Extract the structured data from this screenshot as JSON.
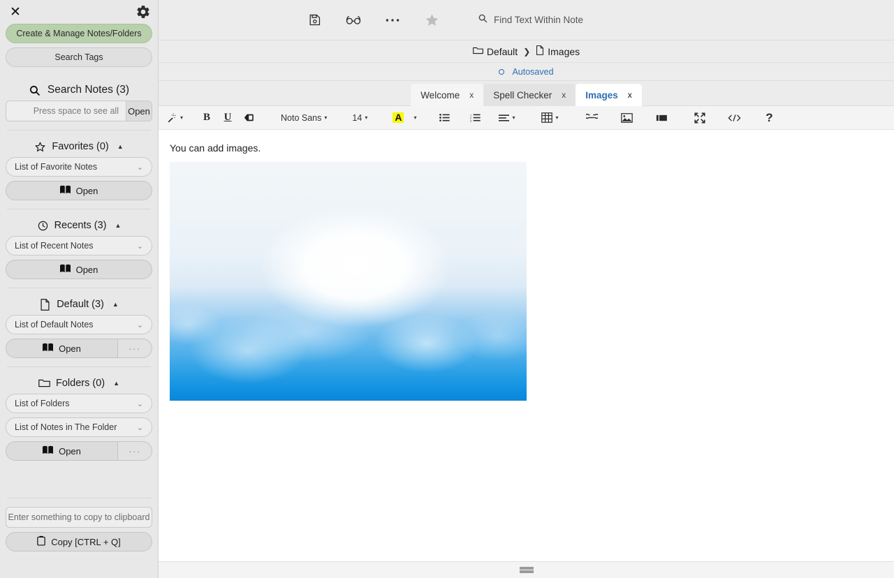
{
  "sidebar": {
    "close_label": "✕",
    "gear_name": "settings-gear",
    "create_manage_label": "Create & Manage Notes/Folders",
    "search_tags_label": "Search Tags",
    "search_notes": {
      "title": "Search Notes (3)",
      "placeholder": "Press space to see all",
      "value": "",
      "open_label": "Open"
    },
    "sections": [
      {
        "id": "favorites",
        "icon": "star-icon",
        "title": "Favorites (0)",
        "caret": "▲",
        "combos": [
          {
            "label": "List of Favorite Notes",
            "chevron": "⌄"
          }
        ],
        "open_label": "Open",
        "has_more": false,
        "more_label": "···"
      },
      {
        "id": "recents",
        "icon": "clock-icon",
        "title": "Recents (3)",
        "caret": "▲",
        "combos": [
          {
            "label": "List of Recent Notes",
            "chevron": "⌄"
          }
        ],
        "open_label": "Open",
        "has_more": false,
        "more_label": "···"
      },
      {
        "id": "default",
        "icon": "file-icon",
        "title": "Default (3)",
        "caret": "▲",
        "combos": [
          {
            "label": "List of Default Notes",
            "chevron": "⌄"
          }
        ],
        "open_label": "Open",
        "has_more": true,
        "more_label": "···"
      },
      {
        "id": "folders",
        "icon": "folder-icon",
        "title": "Folders (0)",
        "caret": "▲",
        "combos": [
          {
            "label": "List of Folders",
            "chevron": "⌄"
          },
          {
            "label": "List of Notes in The Folder",
            "chevron": "⌄"
          }
        ],
        "open_label": "Open",
        "has_more": true,
        "more_label": "···"
      }
    ],
    "clipboard": {
      "placeholder": "Enter something to copy to clipboard",
      "value": "",
      "copy_label": "Copy [CTRL + Q]"
    }
  },
  "topbar": {
    "icons": [
      {
        "name": "save-icon",
        "title": "Save"
      },
      {
        "name": "reading-glasses-icon",
        "title": "Reading mode"
      },
      {
        "name": "ellipsis-icon",
        "title": "More"
      },
      {
        "name": "star-icon",
        "title": "Favorite"
      }
    ],
    "search_placeholder": "Find Text Within Note",
    "search_value": ""
  },
  "breadcrumb": {
    "folder": "Default",
    "separator": "❯",
    "note": "Images"
  },
  "status": {
    "autosaved_label": "Autosaved"
  },
  "tabs": [
    {
      "label": "Welcome",
      "close": "x",
      "active": false
    },
    {
      "label": "Spell Checker",
      "close": "x",
      "active": false
    },
    {
      "label": "Images",
      "close": "x",
      "active": true
    }
  ],
  "format_toolbar": {
    "font_family": "Noto Sans",
    "font_size": "14",
    "caret": "▾",
    "bold_label": "B",
    "underline_label": "U",
    "highlight_letter": "A",
    "help_label": "?",
    "buttons": [
      "magic-wand-icon",
      "bold-button",
      "underline-button",
      "eraser-icon",
      "font-family-select",
      "font-size-select",
      "text-color-button",
      "bullet-list-icon",
      "numbered-list-icon",
      "align-icon",
      "table-icon",
      "link-icon",
      "image-icon",
      "video-icon",
      "fullscreen-icon",
      "code-icon",
      "help-icon"
    ]
  },
  "editor": {
    "note_text": "You can add images.",
    "image_alt": "Blue sky with clouds"
  },
  "colors": {
    "accent_green": "#b8d0ac",
    "link_blue": "#2f6fb5",
    "highlight_yellow": "#f8f800",
    "sidebar_bg": "#e8e8e8",
    "toolbar_bg": "#f4f4f4"
  }
}
